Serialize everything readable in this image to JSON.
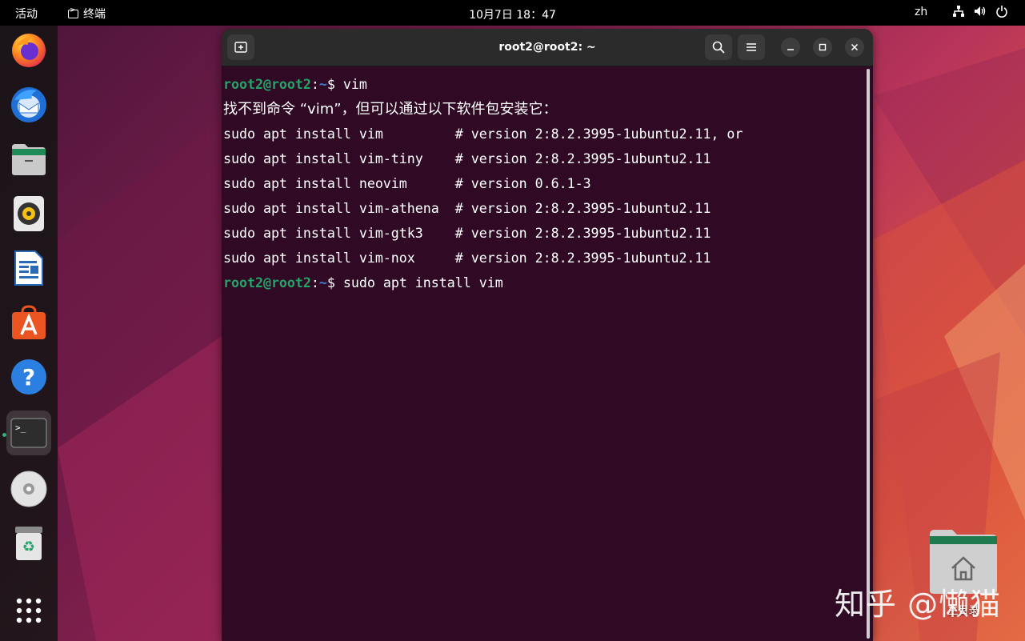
{
  "topbar": {
    "activities": "活动",
    "app_name": "终端",
    "clock": "10月7日  18：47",
    "lang": "zh"
  },
  "dock": {
    "items": [
      "firefox-icon",
      "thunderbird-icon",
      "files-icon",
      "rhythmbox-icon",
      "libreoffice-writer-icon",
      "app-center-icon",
      "help-icon",
      "terminal-icon",
      "disc-icon",
      "trash-icon",
      "show-apps-icon"
    ]
  },
  "terminal": {
    "title": "root2@root2: ~",
    "lines": [
      {
        "type": "prompt",
        "user": "root2@root2",
        "sep": ":",
        "path": "~",
        "dollar": "$ ",
        "cmd": "vim"
      },
      {
        "type": "cjk",
        "text": "找不到命令 “vim”，但可以通过以下软件包安装它："
      },
      {
        "type": "text",
        "text": "sudo apt install vim         # version 2:8.2.3995-1ubuntu2.11, or"
      },
      {
        "type": "text",
        "text": "sudo apt install vim-tiny    # version 2:8.2.3995-1ubuntu2.11"
      },
      {
        "type": "text",
        "text": "sudo apt install neovim      # version 0.6.1-3"
      },
      {
        "type": "text",
        "text": "sudo apt install vim-athena  # version 2:8.2.3995-1ubuntu2.11"
      },
      {
        "type": "text",
        "text": "sudo apt install vim-gtk3    # version 2:8.2.3995-1ubuntu2.11"
      },
      {
        "type": "text",
        "text": "sudo apt install vim-nox     # version 2:8.2.3995-1ubuntu2.11"
      },
      {
        "type": "prompt",
        "user": "root2@root2",
        "sep": ":",
        "path": "~",
        "dollar": "$ ",
        "cmd": "sudo apt install vim"
      }
    ]
  },
  "desktop": {
    "home_label": "主目录"
  },
  "watermark": "知乎 @懒猫",
  "colors": {
    "terminal_bg": "#300a24",
    "prompt_user": "#26a269",
    "prompt_path": "#3d7fd6"
  }
}
